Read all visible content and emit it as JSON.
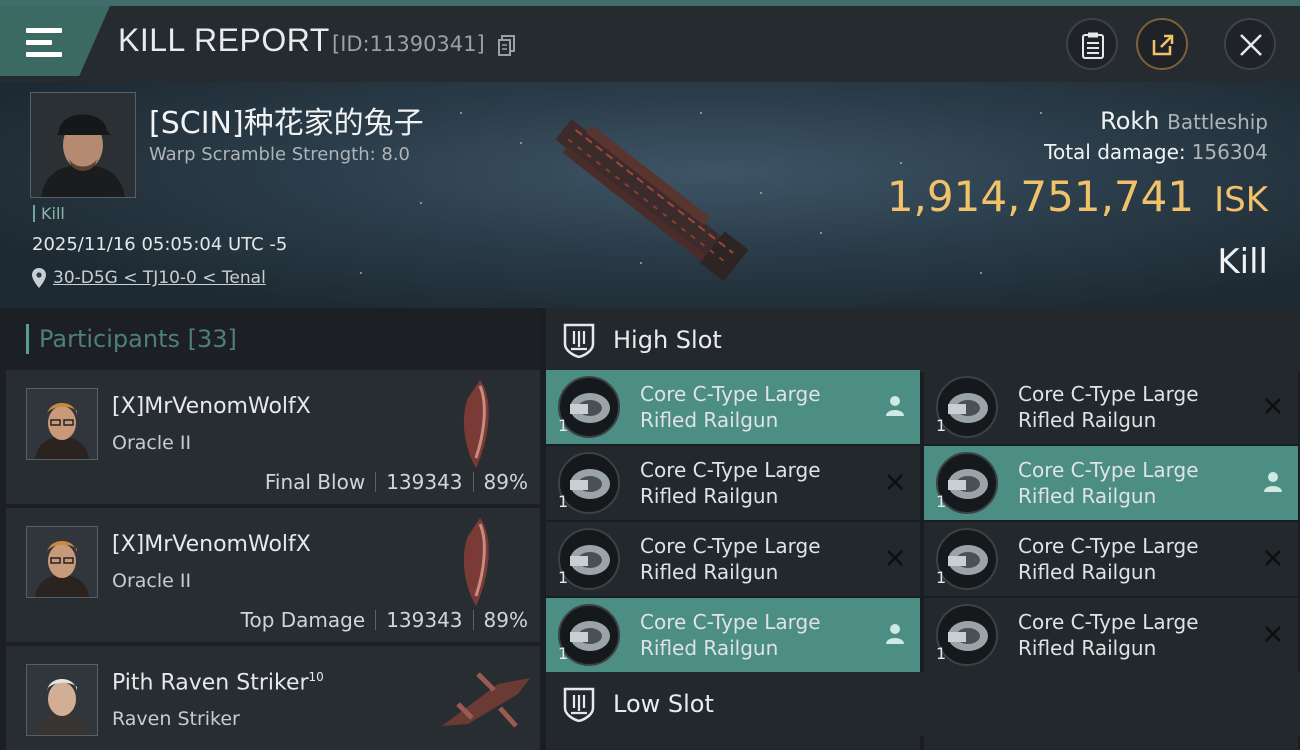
{
  "header": {
    "title": "KILL REPORT",
    "kill_id": "[ID:11390341]"
  },
  "victim": {
    "name": "[SCIN]种花家的兔子",
    "warp_scramble": "Warp Scramble Strength: 8.0",
    "tag": "Kill",
    "time": "2025/11/16 05:05:04 UTC -5",
    "location": "30-D5G < TJ10-0 < Tenal",
    "ship_name": "Rokh",
    "ship_class": "Battleship",
    "total_damage_label": "Total damage:",
    "total_damage": "156304",
    "isk_value": "1,914,751,741",
    "isk_unit": "ISK",
    "result": "Kill"
  },
  "participants": {
    "label": "Participants",
    "count": "[33]",
    "items": [
      {
        "name": "[X]MrVenomWolfX",
        "ship": "Oracle II",
        "role": "Final Blow",
        "damage": "139343",
        "percent": "89%"
      },
      {
        "name": "[X]MrVenomWolfX",
        "ship": "Oracle II",
        "role": "Top Damage",
        "damage": "139343",
        "percent": "89%"
      },
      {
        "name": "Pith Raven Striker",
        "level": "10",
        "ship": "Raven Striker"
      }
    ]
  },
  "slots": {
    "high_label": "High Slot",
    "low_label": "Low Slot",
    "high": [
      {
        "line1": "Core C-Type Large",
        "line2": "Rifled Railgun",
        "qty": "1",
        "status": "person-icon",
        "highlight": true
      },
      {
        "line1": "Core C-Type Large",
        "line2": "Rifled Railgun",
        "qty": "1",
        "status": "destroyed-icon",
        "highlight": false
      },
      {
        "line1": "Core C-Type Large",
        "line2": "Rifled Railgun",
        "qty": "1",
        "status": "destroyed-icon",
        "highlight": false
      },
      {
        "line1": "Core C-Type Large",
        "line2": "Rifled Railgun",
        "qty": "1",
        "status": "person-icon",
        "highlight": true
      },
      {
        "line1": "Core C-Type Large",
        "line2": "Rifled Railgun",
        "qty": "1",
        "status": "destroyed-icon",
        "highlight": false
      },
      {
        "line1": "Core C-Type Large",
        "line2": "Rifled Railgun",
        "qty": "1",
        "status": "destroyed-icon",
        "highlight": false
      },
      {
        "line1": "Core C-Type Large",
        "line2": "Rifled Railgun",
        "qty": "1",
        "status": "person-icon",
        "highlight": true
      },
      {
        "line1": "Core C-Type Large",
        "line2": "Rifled Railgun",
        "qty": "1",
        "status": "destroyed-icon",
        "highlight": false
      }
    ]
  },
  "colors": {
    "accent": "#4c8d84",
    "isk": "#f2c26b"
  }
}
